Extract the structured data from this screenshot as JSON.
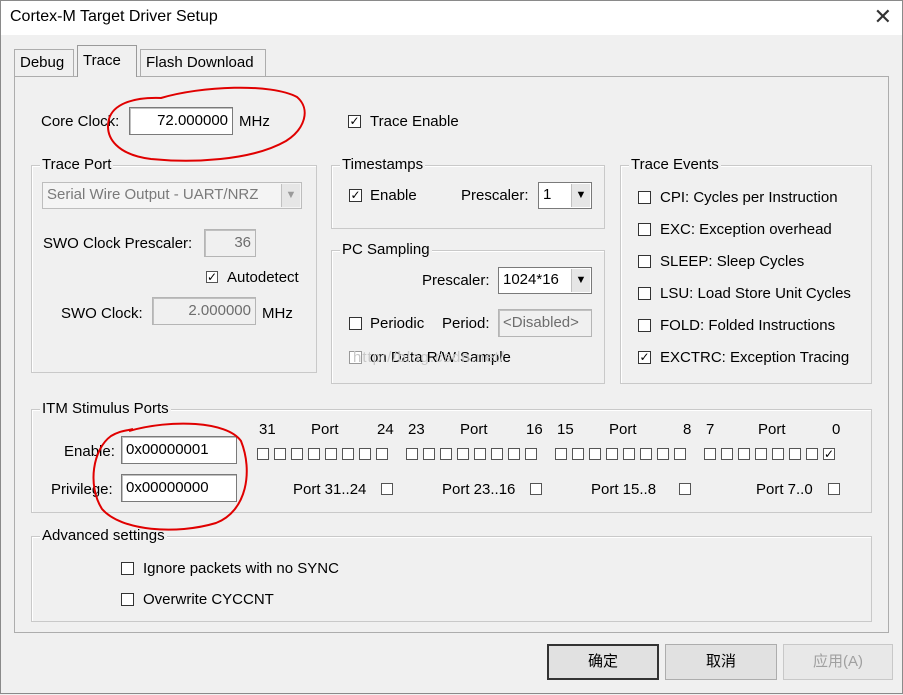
{
  "window": {
    "title": "Cortex-M Target Driver Setup"
  },
  "tabs": [
    {
      "label": "Debug",
      "active": false
    },
    {
      "label": "Trace",
      "active": true
    },
    {
      "label": "Flash Download",
      "active": false
    }
  ],
  "core_clock": {
    "label": "Core Clock:",
    "value": "72.000000",
    "unit": "MHz"
  },
  "trace_enable": {
    "label": "Trace Enable",
    "checked": true
  },
  "trace_port": {
    "legend": "Trace Port",
    "select_value": "Serial Wire Output - UART/NRZ",
    "swo_prescaler_label": "SWO Clock Prescaler:",
    "swo_prescaler_value": "36",
    "autodetect_label": "Autodetect",
    "autodetect_checked": true,
    "swo_clock_label": "SWO Clock:",
    "swo_clock_value": "2.000000",
    "swo_clock_unit": "MHz"
  },
  "timestamps": {
    "legend": "Timestamps",
    "enable_label": "Enable",
    "enable_checked": true,
    "prescaler_label": "Prescaler:",
    "prescaler_value": "1"
  },
  "pc_sampling": {
    "legend": "PC Sampling",
    "prescaler_label": "Prescaler:",
    "prescaler_value": "1024*16",
    "periodic_label": "Periodic",
    "period_label": "Period:",
    "period_value": "<Disabled>",
    "on_data_label": "on Data R/W Sample"
  },
  "trace_events": {
    "legend": "Trace Events",
    "items": [
      {
        "label": "CPI: Cycles per Instruction",
        "checked": false
      },
      {
        "label": "EXC: Exception overhead",
        "checked": false
      },
      {
        "label": "SLEEP: Sleep Cycles",
        "checked": false
      },
      {
        "label": "LSU: Load Store Unit Cycles",
        "checked": false
      },
      {
        "label": "FOLD: Folded Instructions",
        "checked": false
      },
      {
        "label": "EXCTRC: Exception Tracing",
        "checked": true
      }
    ]
  },
  "itm": {
    "legend": "ITM Stimulus Ports",
    "enable_label": "Enable:",
    "enable_value": "0x00000001",
    "privilege_label": "Privilege:",
    "privilege_value": "0x00000000",
    "header_groups": [
      {
        "hi": "31",
        "port": "Port",
        "lo": "24"
      },
      {
        "hi": "23",
        "port": "Port",
        "lo": "16"
      },
      {
        "hi": "15",
        "port": "Port",
        "lo": "8"
      },
      {
        "hi": "7",
        "port": "Port",
        "lo": "0"
      }
    ],
    "privilege_groups": [
      {
        "label": "Port 31..24",
        "checked": false
      },
      {
        "label": "Port 23..16",
        "checked": false
      },
      {
        "label": "Port 15..8",
        "checked": false
      },
      {
        "label": "Port 7..0",
        "checked": false
      }
    ],
    "enabled_bit": 0
  },
  "advanced": {
    "legend": "Advanced settings",
    "ignore_sync_label": "Ignore packets with no SYNC",
    "ignore_sync_checked": false,
    "overwrite_label": "Overwrite CYCCNT",
    "overwrite_checked": false
  },
  "buttons": {
    "ok": "确定",
    "cancel": "取消",
    "apply": "应用(A)"
  },
  "watermark": "http://blog.csdn.net/",
  "colors": {
    "annotation": "#e00000",
    "window_bg": "#f0f0f0"
  }
}
